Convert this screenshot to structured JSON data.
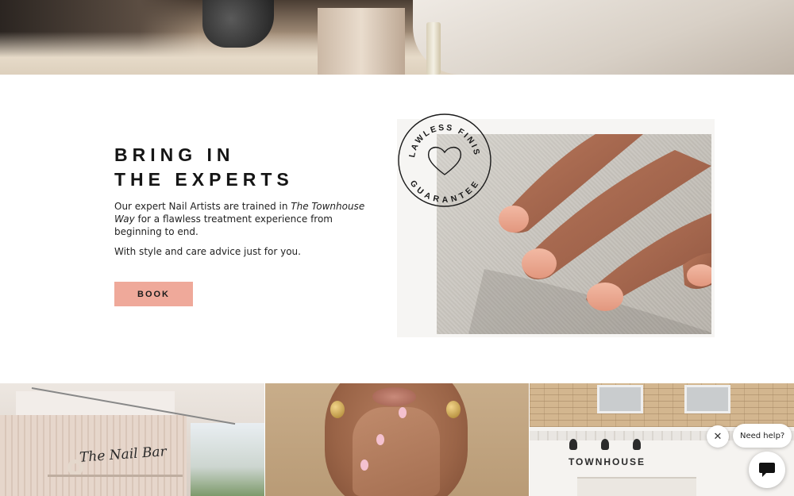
{
  "hero": {
    "image": "nail-technician-at-work-photo"
  },
  "experts": {
    "title_line1": "BRING IN",
    "title_line2": "THE EXPERTS",
    "copy_part1": "Our expert Nail Artists are trained in ",
    "copy_em": "The Townhouse Way",
    "copy_part2": " for a flawless treatment experience from beginning to end.",
    "copy_para2": "With style and care advice just for you.",
    "book_label": "BOOK",
    "book_color": "#efa99a"
  },
  "badge": {
    "top_text": "FLAWLESS FINISH",
    "bottom_text": "GUARANTEE",
    "icon": "heart-icon"
  },
  "hand_image": {
    "image": "manicured-hand-on-knit-fabric"
  },
  "tiles": {
    "bar_sign": "The Nail Bar",
    "shop_sign": "TOWNHOUSE"
  },
  "chat": {
    "bubble_text": "Need help?",
    "close_icon": "close-icon",
    "chat_icon": "chat-icon"
  }
}
